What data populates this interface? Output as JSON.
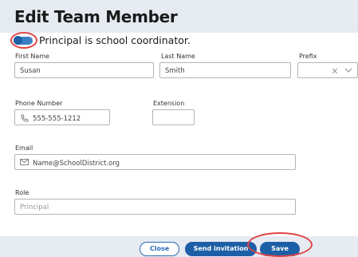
{
  "dialog": {
    "title": "Edit Team Member"
  },
  "coordinator": {
    "label": "Principal is school coordinator.",
    "enabled": true
  },
  "fields": {
    "first_name": {
      "label": "First Name",
      "value": "Susan"
    },
    "last_name": {
      "label": "Last Name",
      "value": "Smith"
    },
    "prefix": {
      "label": "Prefix",
      "value": ""
    },
    "phone": {
      "label": "Phone Number",
      "value": "555-555-1212"
    },
    "extension": {
      "label": "Extension",
      "value": ""
    },
    "email": {
      "label": "Email",
      "placeholder": "Name@SchoolDistrict.org"
    },
    "role": {
      "label": "Role",
      "placeholder": "Principal"
    }
  },
  "icons": {
    "clear": "close-icon",
    "dropdown": "chevron-down-icon",
    "phone": "phone-icon",
    "email": "envelope-icon"
  },
  "footer": {
    "close_label": "Close",
    "invite_label": "Send invitation",
    "save_label": "Save"
  },
  "colors": {
    "accent": "#1d5fa6",
    "highlight": "#e04444",
    "toggle": "#3b7fc4"
  }
}
